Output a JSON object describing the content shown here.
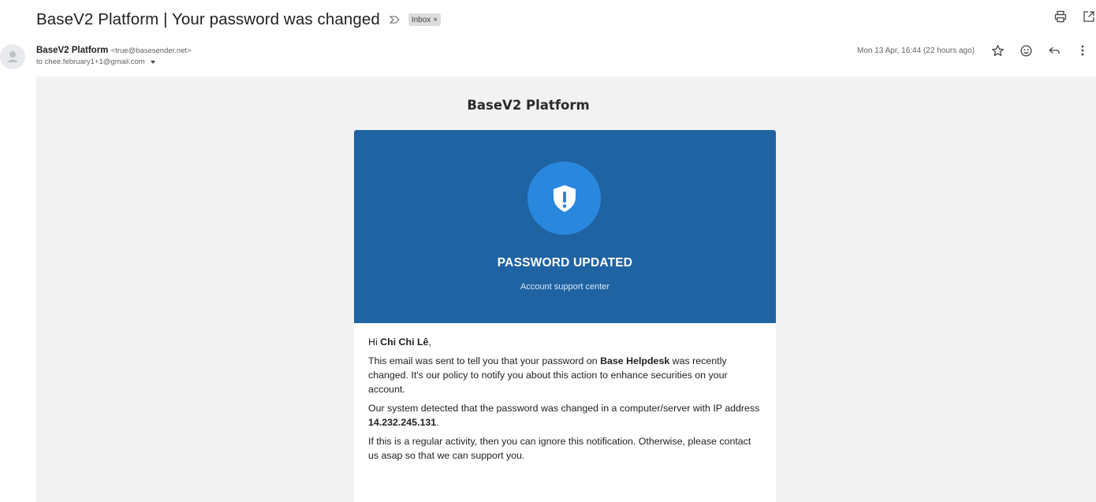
{
  "header": {
    "subject": "BaseV2 Platform | Your password was changed",
    "label_chip": "Inbox",
    "label_chip_close": "×"
  },
  "sender": {
    "name": "BaseV2 Platform",
    "email": "<true@basesender.net>",
    "to_line": "to chee.february1+1@gmail.com",
    "date": "Mon 13 Apr, 16:44 (22 hours ago)"
  },
  "icons": {
    "top_actions": [
      "print-icon",
      "open-in-new-window-icon"
    ],
    "meta_actions": [
      "star-icon",
      "emoji-reaction-icon",
      "reply-icon",
      "more-options-icon"
    ],
    "important": "important-marker-icon",
    "banner": "shield-alert-icon"
  },
  "colors": {
    "banner_bg": "#1f63a3",
    "shield_circle": "#2a87de",
    "panel_bg": "#f2f2f2"
  },
  "email": {
    "brand_title": "BaseV2 Platform",
    "banner_title": "PASSWORD UPDATED",
    "banner_subtitle": "Account support center",
    "greeting_prefix": "Hi ",
    "greeting_name": "Chi Chi Lê",
    "greeting_suffix": ",",
    "p1_a": "This email was sent to tell you that your password on ",
    "p1_bold": "Base Helpdesk",
    "p1_b": " was recently changed. It's our policy to notify you about this action to enhance securities on your account.",
    "p2_a": "Our system detected that the password was changed in a computer/server with IP address ",
    "p2_bold": "14.232.245.131",
    "p2_b": ".",
    "p3": "If this is a regular activity, then you can ignore this notification. Otherwise, please contact us asap so that we can support you."
  }
}
